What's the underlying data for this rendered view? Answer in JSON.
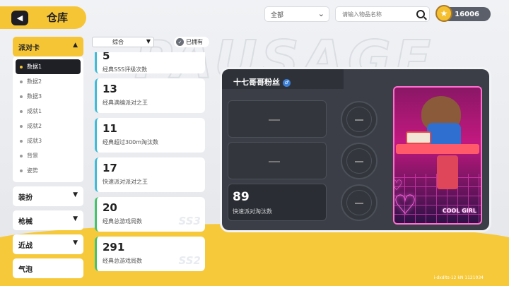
{
  "header": {
    "title": "仓库",
    "back_icon": "◀",
    "filter_value": "全部",
    "search_placeholder": "请输入物品名称",
    "currency_amount": "16006"
  },
  "menu": {
    "categories": [
      {
        "label": "派对卡",
        "chevron": "▲",
        "active": true
      },
      {
        "label": "装扮",
        "chevron": "▼"
      },
      {
        "label": "枪械",
        "chevron": "▼"
      },
      {
        "label": "近战",
        "chevron": "▼"
      },
      {
        "label": "气泡",
        "chevron": ""
      }
    ],
    "subitems": [
      "数据1",
      "数据2",
      "数据3",
      "成就1",
      "成就2",
      "成就3",
      "背景",
      "姿势"
    ]
  },
  "filters": {
    "sort_label": "综合",
    "owned_label": "已拥有"
  },
  "stat_cards": [
    {
      "value": "5",
      "label": "经典SSS评级次数",
      "watermark": ""
    },
    {
      "value": "13",
      "label": "经典满编派对之王",
      "watermark": ""
    },
    {
      "value": "11",
      "label": "经典超过300m淘汰数",
      "watermark": ""
    },
    {
      "value": "17",
      "label": "快速派对派对之王",
      "watermark": ""
    },
    {
      "value": "20",
      "label": "经典总游戏局数",
      "watermark": "SS3"
    },
    {
      "value": "291",
      "label": "经典总游戏局数",
      "watermark": "SS2"
    }
  ],
  "panel": {
    "player_name": "十七哥哥粉丝",
    "gender_icon": "♂",
    "filled_slot_value": "89",
    "filled_slot_label": "快速派对淘汰数",
    "card_art_text": "COOL GIRL"
  },
  "footer": {
    "id_text": "i-dxdlts-12 kN 1121034"
  }
}
